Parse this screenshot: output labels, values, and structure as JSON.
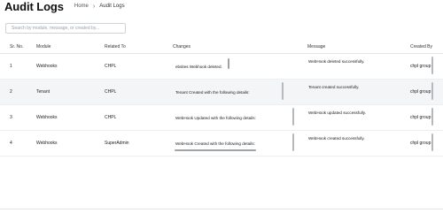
{
  "header": {
    "title": "Audit Logs",
    "breadcrumb": {
      "home": "Home",
      "current": "Audit Logs"
    }
  },
  "search": {
    "placeholder": "Search by module, message, or created by...",
    "value": ""
  },
  "table": {
    "columns": {
      "sr_no": "Sr. No.",
      "module": "Module",
      "related_to": "Related To",
      "changes": "Changes",
      "message": "Message",
      "created_by": "Created By"
    },
    "rows": [
      {
        "sr_no": "1",
        "module": "Webhooks",
        "related_to": "CHPL",
        "changes": "ebsites Webhook deleted.",
        "message": "WebHook deleted successfully.",
        "created_by": "chpl group"
      },
      {
        "sr_no": "2",
        "module": "Tenant",
        "related_to": "CHPL",
        "changes": "Tenant Created with the following details:",
        "message": "Tenant created successfully.",
        "created_by": "chpl group"
      },
      {
        "sr_no": "3",
        "module": "Webhooks",
        "related_to": "CHPL",
        "changes": "WebHook Updated with the following details:",
        "message": "WebHook updated successfully.",
        "created_by": "chpl group"
      },
      {
        "sr_no": "4",
        "module": "Webhooks",
        "related_to": "SuperAdmin",
        "changes": "WebHook Created with the following details:",
        "message": "WebHook created successfully.",
        "created_by": "chpl group"
      }
    ]
  },
  "icons": {
    "breadcrumb_separator": "chevron-right-icon"
  }
}
